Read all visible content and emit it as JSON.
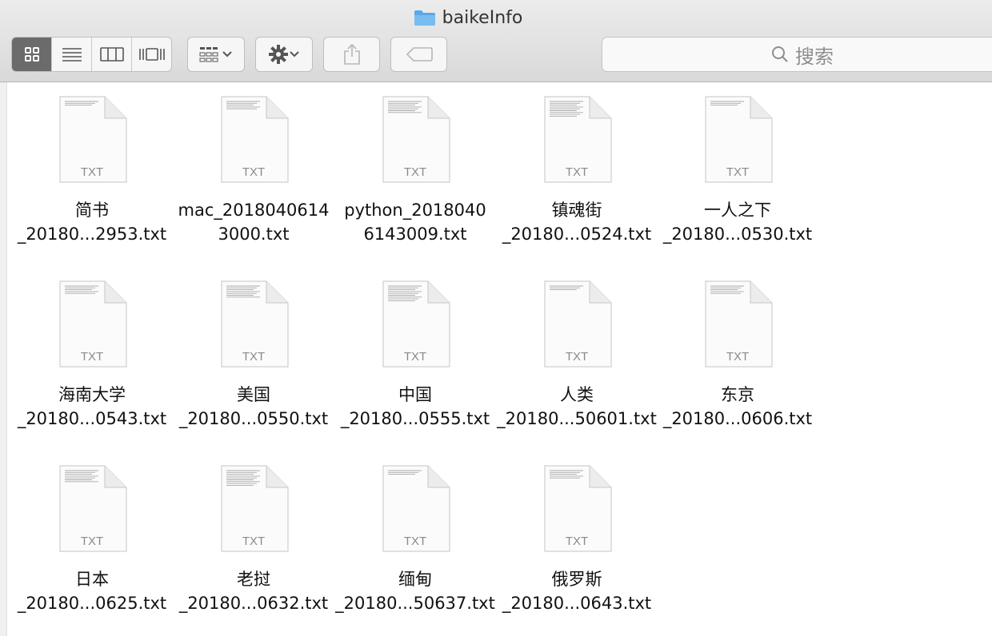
{
  "window": {
    "title": "baikeInfo"
  },
  "toolbar": {
    "view_modes": [
      "icon-view",
      "list-view",
      "column-view",
      "cover-flow-view"
    ],
    "search_placeholder": "搜索"
  },
  "files": [
    {
      "line1": "简书",
      "line2": "_20180...2953.txt",
      "type": "TXT"
    },
    {
      "line1": "mac_2018040614",
      "line2": "3000.txt",
      "type": "TXT"
    },
    {
      "line1": "python_2018040",
      "line2": "6143009.txt",
      "type": "TXT"
    },
    {
      "line1": "镇魂街",
      "line2": "_20180...0524.txt",
      "type": "TXT"
    },
    {
      "line1": "一人之下",
      "line2": "_20180...0530.txt",
      "type": "TXT"
    },
    {
      "line1": "海南大学",
      "line2": "_20180...0543.txt",
      "type": "TXT"
    },
    {
      "line1": "美国",
      "line2": "_20180...0550.txt",
      "type": "TXT"
    },
    {
      "line1": "中国",
      "line2": "_20180...0555.txt",
      "type": "TXT"
    },
    {
      "line1": "人类",
      "line2": "_20180...50601.txt",
      "type": "TXT"
    },
    {
      "line1": "东京",
      "line2": "_20180...0606.txt",
      "type": "TXT"
    },
    {
      "line1": "日本",
      "line2": "_20180...0625.txt",
      "type": "TXT"
    },
    {
      "line1": "老挝",
      "line2": "_20180...0632.txt",
      "type": "TXT"
    },
    {
      "line1": "缅甸",
      "line2": "_20180...50637.txt",
      "type": "TXT"
    },
    {
      "line1": "俄罗斯",
      "line2": "_20180...0643.txt",
      "type": "TXT"
    }
  ]
}
